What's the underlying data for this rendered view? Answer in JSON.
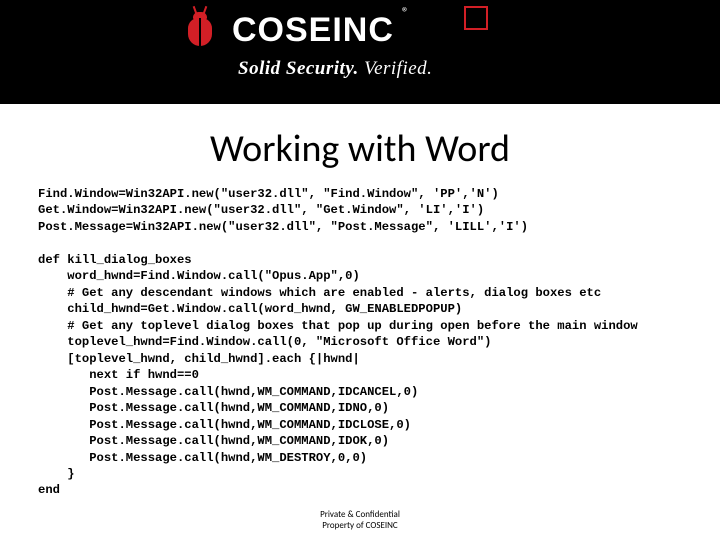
{
  "header": {
    "brand": "COSEINC",
    "registered": "®",
    "tagline_bold": "Solid Security.",
    "tagline_light": "Verified."
  },
  "title": "Working with Word",
  "code_block": "Find.Window=Win32API.new(\"user32.dll\", \"Find.Window\", 'PP','N')\nGet.Window=Win32API.new(\"user32.dll\", \"Get.Window\", 'LI','I')\nPost.Message=Win32API.new(\"user32.dll\", \"Post.Message\", 'LILL','I')\n\ndef kill_dialog_boxes\n    word_hwnd=Find.Window.call(\"Opus.App\",0)\n    # Get any descendant windows which are enabled - alerts, dialog boxes etc\n    child_hwnd=Get.Window.call(word_hwnd, GW_ENABLEDPOPUP)\n    # Get any toplevel dialog boxes that pop up during open before the main window\n    toplevel_hwnd=Find.Window.call(0, \"Microsoft Office Word\")\n    [toplevel_hwnd, child_hwnd].each {|hwnd|\n       next if hwnd==0\n       Post.Message.call(hwnd,WM_COMMAND,IDCANCEL,0)\n       Post.Message.call(hwnd,WM_COMMAND,IDNO,0)\n       Post.Message.call(hwnd,WM_COMMAND,IDCLOSE,0)\n       Post.Message.call(hwnd,WM_COMMAND,IDOK,0)\n       Post.Message.call(hwnd,WM_DESTROY,0,0)\n    }\nend",
  "footer": {
    "line1": "Private & Confidential",
    "line2": "Property of COSEINC"
  }
}
